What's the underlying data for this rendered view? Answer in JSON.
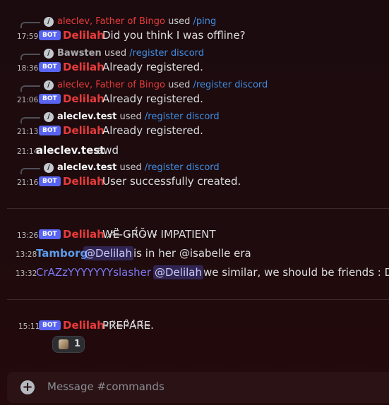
{
  "messages": [
    {
      "reply_user": "aleclev, Father of Bingo",
      "reply_used": "used",
      "reply_cmd": "/ping",
      "time": "17:59",
      "badge": "BOT",
      "author": "Delilah",
      "text": "Did you think I was offline?"
    },
    {
      "reply_user": "Bawsten",
      "reply_used": "used",
      "reply_cmd": "/register discord",
      "time": "18:36",
      "badge": "BOT",
      "author": "Delilah",
      "text": "Already registered."
    },
    {
      "reply_user": "aleclev, Father of Bingo",
      "reply_used": "used",
      "reply_cmd": "/register discord",
      "time": "21:06",
      "badge": "BOT",
      "author": "Delilah",
      "text": "Already registered."
    },
    {
      "reply_user": "aleclev.test",
      "reply_used": "used",
      "reply_cmd": "/register discord",
      "time": "21:13",
      "badge": "BOT",
      "author": "Delilah",
      "text": "Already registered."
    },
    {
      "time": "21:14",
      "author": "aleclev.test",
      "text": "awd"
    },
    {
      "reply_user": "aleclev.test",
      "reply_used": "used",
      "reply_cmd": "/register discord",
      "time": "21:16",
      "badge": "BOT",
      "author": "Delilah",
      "text": "User successfully created."
    },
    {
      "time": "13:26",
      "badge": "BOT",
      "author": "Delilah",
      "text": "W̷̛Ë̶́ ̵G̵R̵̈́Ŏ̵W̵ IMPATIENT"
    },
    {
      "time": "13:28",
      "author": "Tamborg",
      "mention": "@Delilah",
      "text": "is in her @isabelle era"
    },
    {
      "time": "13:32",
      "author": "CrAZzYYYYYYYslasher",
      "mention": "@Delilah",
      "text": "we similar, we should be friends : D. /Fr"
    },
    {
      "time": "15:11",
      "badge": "BOT",
      "author": "Delilah",
      "text": "P̵R̷̈E̶P̵̊A̵̓R̴̆E̴."
    }
  ],
  "reaction": {
    "emoji": "bird-emoji",
    "count": "1"
  },
  "composer": {
    "placeholder": "Message #commands",
    "icon": "plus-circle-icon"
  },
  "icons": {
    "reply_slash": "slash-command-icon"
  },
  "colors": {
    "bot_badge": "#5865f2",
    "delilah": "#e63b3b",
    "command_link": "#3f8ee3",
    "mention_bg": "#5865f24d"
  }
}
